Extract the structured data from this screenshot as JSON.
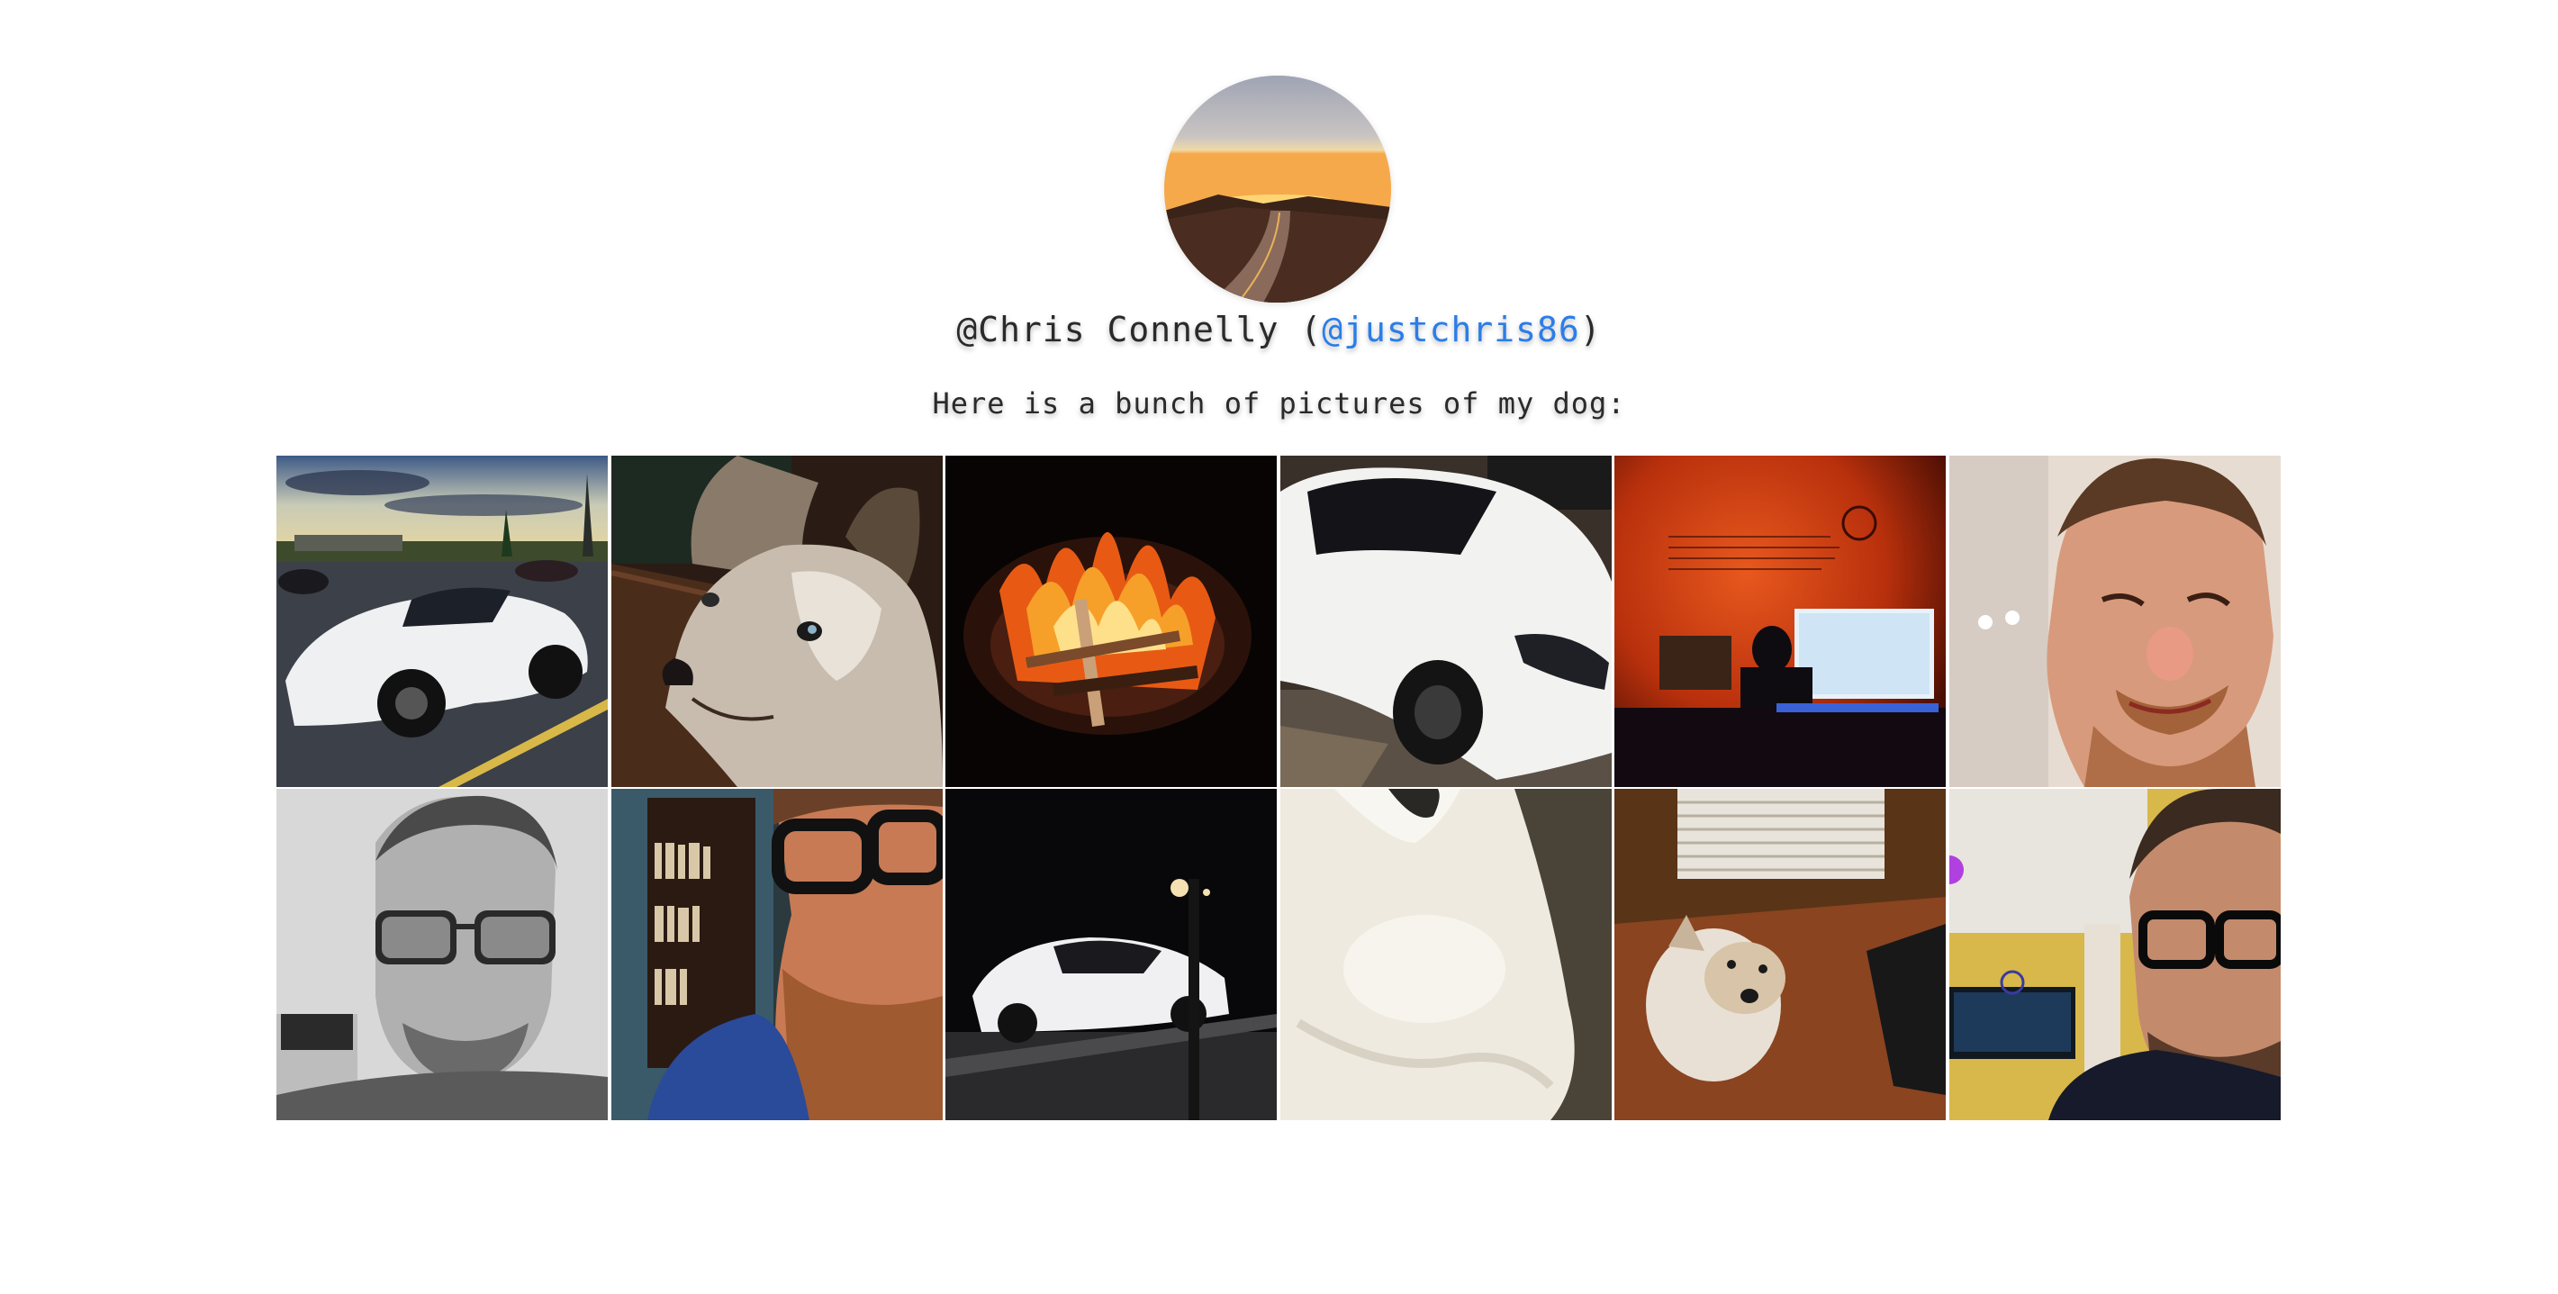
{
  "profile": {
    "name_prefix": "@Chris Connelly (",
    "handle": "@justchris86",
    "name_suffix": ")",
    "bio": "Here is a bunch of pictures of my dog:",
    "avatar_icon": "sunset-road-photo"
  },
  "colors": {
    "link": "#2b7de9",
    "text": "#2a2a2a",
    "background": "#ffffff"
  },
  "photos": [
    {
      "subject": "white-sports-car-parking-lot"
    },
    {
      "subject": "husky-dog-closeup"
    },
    {
      "subject": "campfire-night"
    },
    {
      "subject": "white-car-front-closeup"
    },
    {
      "subject": "computer-desk-orange-wall"
    },
    {
      "subject": "selfie-smiling-man"
    },
    {
      "subject": "selfie-grayscale-glasses"
    },
    {
      "subject": "selfie-bookshelf-glasses"
    },
    {
      "subject": "white-car-night-street"
    },
    {
      "subject": "white-dog-fur-closeup"
    },
    {
      "subject": "dog-sitting-wood-floor"
    },
    {
      "subject": "selfie-room-glasses"
    }
  ]
}
